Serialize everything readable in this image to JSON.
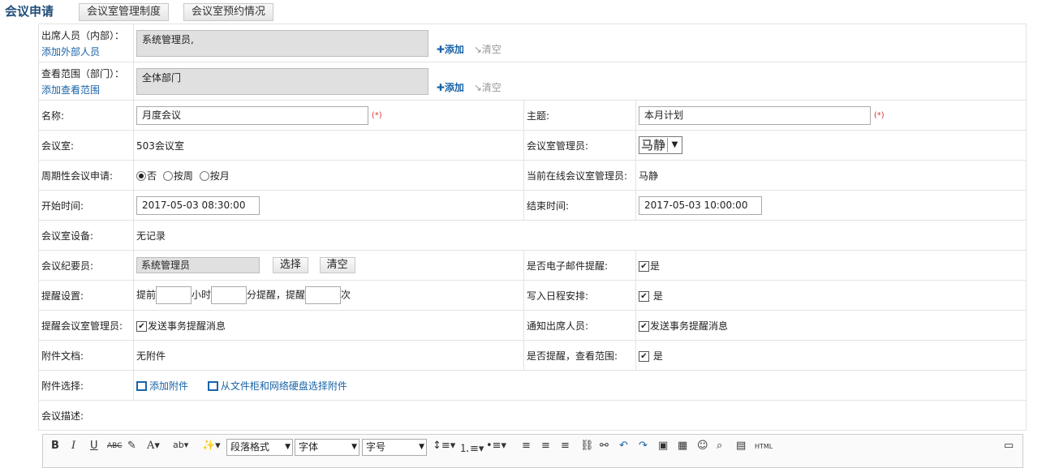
{
  "header": {
    "title": "会议申请",
    "tabs": [
      "会议室管理制度",
      "会议室预约情况"
    ]
  },
  "attendees": {
    "label": "出席人员（内部）：",
    "add_external": "添加外部人员",
    "value": "系统管理员,",
    "add": "添加",
    "clear": "清空"
  },
  "scope": {
    "label": "查看范围（部门）：",
    "add_link": "添加查看范围",
    "value": "全体部门",
    "add": "添加",
    "clear": "清空"
  },
  "name": {
    "label": "名称:",
    "value": "月度会议",
    "required": "(*)"
  },
  "subject": {
    "label": "主题:",
    "value": "本月计划",
    "required": "(*)"
  },
  "room": {
    "label": "会议室:",
    "value": "503会议室"
  },
  "room_admin": {
    "label": "会议室管理员:",
    "value": "马静"
  },
  "periodic": {
    "label": "周期性会议申请:",
    "options": [
      "否",
      "按周",
      "按月"
    ],
    "selected": "否"
  },
  "online_admin": {
    "label": "当前在线会议室管理员:",
    "value": "马静"
  },
  "start": {
    "label": "开始时间:",
    "value": "2017-05-03 08:30:00"
  },
  "end": {
    "label": "结束时间:",
    "value": "2017-05-03 10:00:00"
  },
  "equipment": {
    "label": "会议室设备:",
    "value": "无记录"
  },
  "recorder": {
    "label": "会议纪要员:",
    "value": "系统管理员",
    "select": "选择",
    "clear": "清空"
  },
  "email_remind": {
    "label": "是否电子邮件提醒:",
    "checkbox": "是",
    "checked": true
  },
  "remind": {
    "label": "提醒设置:",
    "before": "提前",
    "hours": "小时",
    "minutes": "分提醒，提醒",
    "times": "次"
  },
  "schedule": {
    "label": "写入日程安排:",
    "checkbox": "是",
    "checked": true
  },
  "remind_admin": {
    "label": "提醒会议室管理员:",
    "checkbox": "发送事务提醒消息",
    "checked": true
  },
  "notify": {
    "label": "通知出席人员:",
    "checkbox": "发送事务提醒消息",
    "checked": true
  },
  "attachment_doc": {
    "label": "附件文档:",
    "value": "无附件"
  },
  "remind_scope": {
    "label": "是否提醒，查看范围:",
    "checkbox": "是",
    "checked": true
  },
  "attachment_select": {
    "label": "附件选择:",
    "add": "添加附件",
    "from_cabinet": "从文件柜和网络硬盘选择附件"
  },
  "description": {
    "label": "会议描述:"
  },
  "editor": {
    "paragraph": "段落格式",
    "font": "字体",
    "size": "字号",
    "html": "HTML"
  }
}
